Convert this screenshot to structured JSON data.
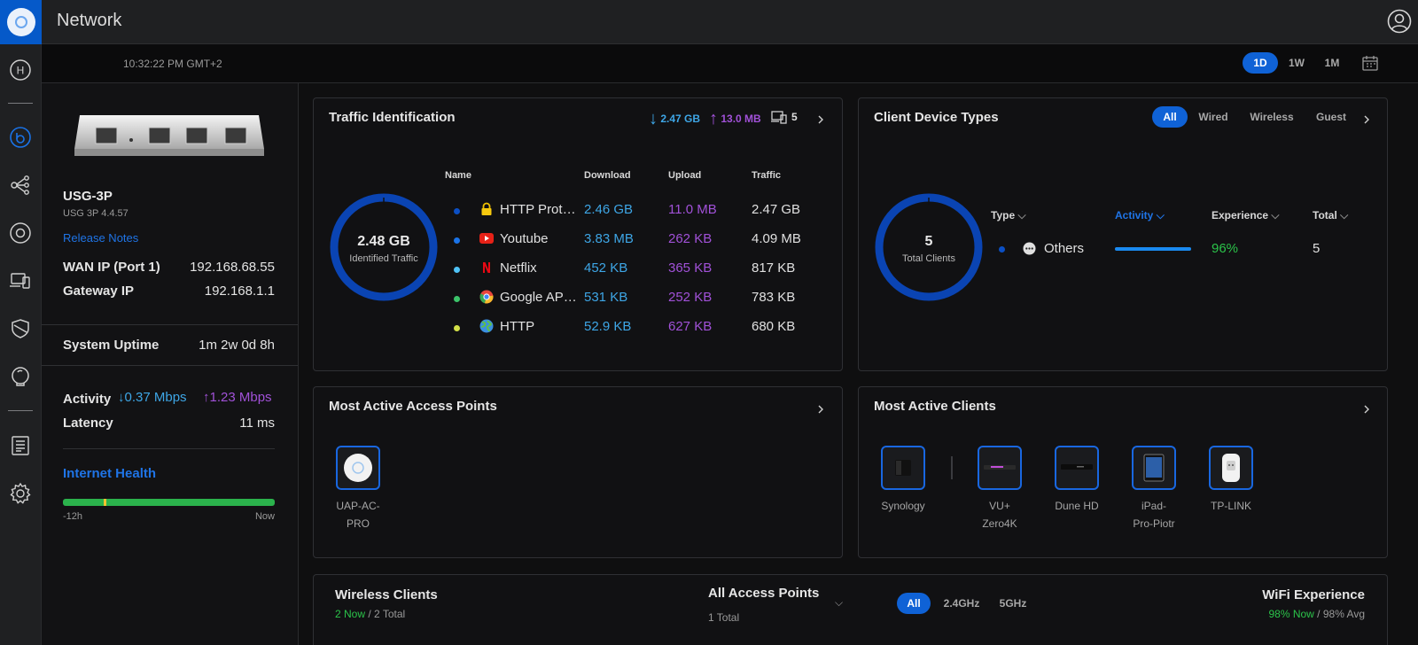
{
  "app": {
    "title": "Network"
  },
  "header": {
    "time": "10:32:22 PM GMT+2",
    "ranges": [
      "1D",
      "1W",
      "1M"
    ],
    "active_range": "1D"
  },
  "nav": {
    "home_letter": "H"
  },
  "device": {
    "name": "USG-3P",
    "model": "USG 3P 4.4.57",
    "release_notes": "Release Notes",
    "wan_ip_label": "WAN IP (Port 1)",
    "wan_ip": "192.168.68.55",
    "gateway_label": "Gateway IP",
    "gateway_ip": "192.168.1.1",
    "uptime_label": "System Uptime",
    "uptime": "1m 2w 0d 8h",
    "activity_label": "Activity",
    "activity_down": "0.37 Mbps",
    "activity_up": "1.23 Mbps",
    "latency_label": "Latency",
    "latency": "11 ms",
    "health_title": "Internet Health",
    "health_start": "-12h",
    "health_end": "Now",
    "health_good_color": "#2bb24c",
    "health_warn_color": "#f2c230"
  },
  "traffic": {
    "title": "Traffic Identification",
    "down_total": "2.47 GB",
    "up_total": "13.0 MB",
    "clients": "5",
    "donut_value": "2.48 GB",
    "donut_label": "Identified Traffic",
    "columns": [
      "Name",
      "Download",
      "Upload",
      "Traffic"
    ],
    "rows": [
      {
        "name": "HTTP Prot…",
        "download": "2.46 GB",
        "upload": "11.0 MB",
        "traffic": "2.47 GB",
        "dot": "#0b4fc4",
        "icon": "lock-icon"
      },
      {
        "name": "Youtube",
        "download": "3.83 MB",
        "upload": "262 KB",
        "traffic": "4.09 MB",
        "dot": "#1a73e8",
        "icon": "youtube-icon"
      },
      {
        "name": "Netflix",
        "download": "452 KB",
        "upload": "365 KB",
        "traffic": "817 KB",
        "dot": "#4fc3f7",
        "icon": "netflix-icon"
      },
      {
        "name": "Google AP…",
        "download": "531 KB",
        "upload": "252 KB",
        "traffic": "783 KB",
        "dot": "#3cc46a",
        "icon": "chrome-icon"
      },
      {
        "name": "HTTP",
        "download": "52.9 KB",
        "upload": "627 KB",
        "traffic": "680 KB",
        "dot": "#d3e048",
        "icon": "globe-icon"
      }
    ]
  },
  "client_types": {
    "title": "Client Device Types",
    "tabs": [
      "All",
      "Wired",
      "Wireless",
      "Guest"
    ],
    "active_tab": "All",
    "donut_value": "5",
    "donut_label": "Total Clients",
    "columns": [
      "Type",
      "Activity",
      "Experience",
      "Total"
    ],
    "row": {
      "type": "Others",
      "experience": "96%",
      "total": "5",
      "activity_fraction": 1.0
    }
  },
  "access_points": {
    "title": "Most Active Access Points",
    "items": [
      {
        "label": "UAP-AC-\nPRO"
      }
    ]
  },
  "active_clients": {
    "title": "Most Active Clients",
    "items": [
      {
        "label": "Synology"
      },
      {
        "label": "VU+\nZero4K"
      },
      {
        "label": "Dune HD"
      },
      {
        "label": "iPad-\nPro-Piotr"
      },
      {
        "label": "TP-LINK"
      }
    ]
  },
  "wireless": {
    "title": "Wireless Clients",
    "now": "2 Now",
    "total": "/ 2 Total",
    "ap_title": "All Access Points",
    "ap_total": "1 Total",
    "bands": [
      "All",
      "2.4GHz",
      "5GHz"
    ],
    "active_band": "All",
    "wifi_title": "WiFi Experience",
    "wifi_now": "98% Now",
    "wifi_avg": "/ 98% Avg"
  },
  "colors": {
    "accent": "#0f62d6",
    "download": "#3ea6e6",
    "upload": "#a151d8",
    "good": "#2bb24c"
  }
}
